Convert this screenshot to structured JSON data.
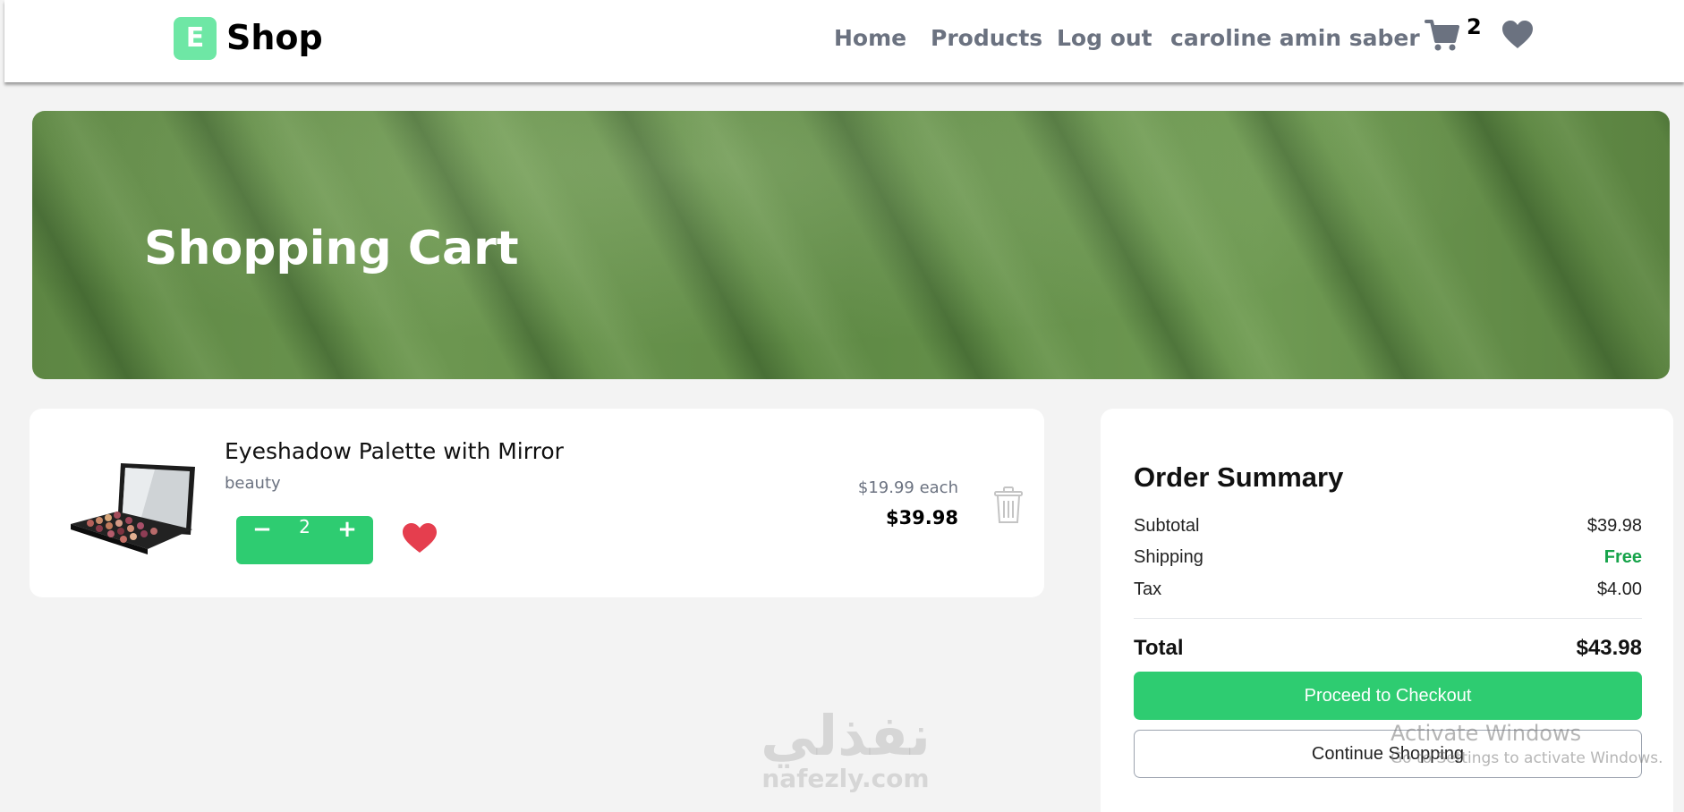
{
  "navbar": {
    "logo_letter": "E",
    "logo_text": "Shop",
    "links": [
      "Home",
      "Products",
      "Log out",
      "caroline amin saber"
    ],
    "cart_count": "2",
    "icons": {
      "cart": "cart-icon",
      "wishlist": "heart-icon"
    }
  },
  "hero": {
    "title": "Shopping Cart"
  },
  "cart_item": {
    "name": "Eyeshadow Palette with Mirror",
    "category": "beauty",
    "quantity": "2",
    "minus_label": "−",
    "plus_label": "+",
    "unit_price": "$19.99 each",
    "line_total": "$39.98",
    "icons": {
      "favorite": "heart-icon",
      "remove": "trash-icon"
    }
  },
  "summary": {
    "title": "Order Summary",
    "rows": [
      {
        "label": "Subtotal",
        "value": "$39.98"
      },
      {
        "label": "Shipping",
        "value": "Free"
      },
      {
        "label": "Tax",
        "value": "$4.00"
      }
    ],
    "total_label": "Total",
    "total_value": "$43.98",
    "checkout_label": "Proceed to Checkout",
    "continue_label": "Continue Shopping"
  },
  "overlay": {
    "watermark_ar": "نفذلي",
    "watermark_en": "nafezly.com",
    "activate_title": "Activate Windows",
    "activate_sub": "Go to Settings to activate Windows."
  },
  "colors": {
    "brand_green": "#2ecc71",
    "logo_green": "#6ee7a5",
    "heart_red": "#e53e4e",
    "nav_gray": "#6b7280",
    "free_green": "#16a34a"
  }
}
